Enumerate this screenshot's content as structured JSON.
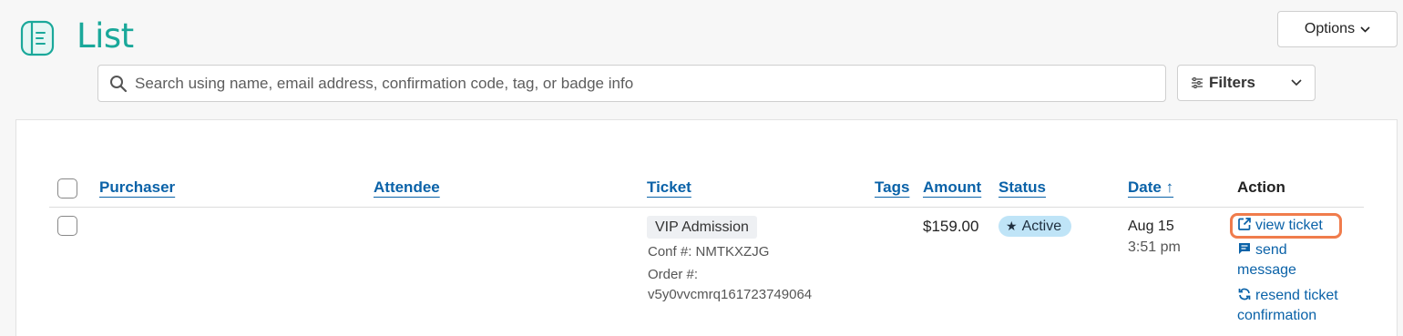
{
  "header": {
    "title": "List",
    "options_label": "Options",
    "search_placeholder": "Search using name, email address, confirmation code, tag, or badge info",
    "filters_label": "Filters"
  },
  "table": {
    "columns": [
      "Purchaser",
      "Attendee",
      "Ticket",
      "Tags",
      "Amount",
      "Status",
      "Date ↑",
      "Action"
    ],
    "rows": [
      {
        "ticket_type": "VIP Admission",
        "conf": "Conf #: NMTKXZJG",
        "order_label": "Order #:",
        "order_id": "v5y0vvcmrq161723749064",
        "amount": "$159.00",
        "status": "Active",
        "date": "Aug 15",
        "time": "3:51 pm",
        "actions": {
          "view_ticket": "view ticket",
          "send_message_1": "send",
          "send_message_2": "message",
          "resend_1": "resend ticket",
          "resend_2": "confirmation"
        }
      }
    ]
  },
  "colors": {
    "accent": "#1aa89a",
    "link": "#0a62a8",
    "status_bg": "#bfe4f7",
    "highlight": "#f07c4c"
  },
  "icons": {
    "logo": "list-book-icon",
    "search": "search-icon",
    "filters": "sliders-icon",
    "view": "external-link-icon",
    "message": "message-icon",
    "resend": "refresh-icon",
    "status": "star-icon"
  }
}
